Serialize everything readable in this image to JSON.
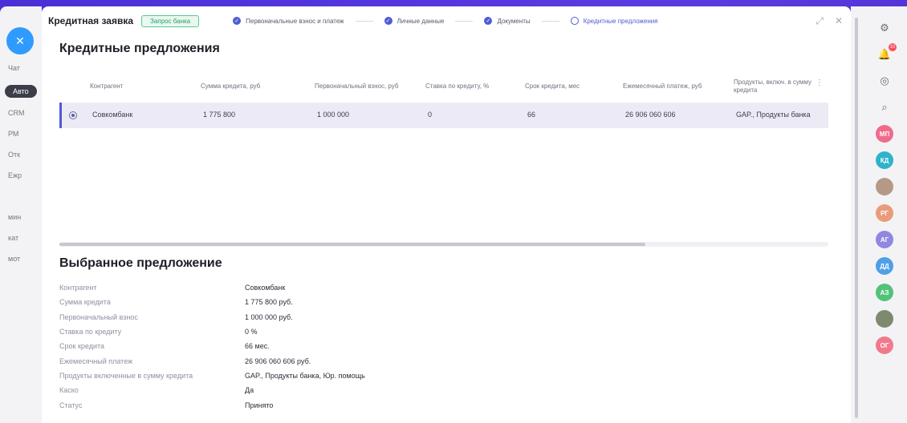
{
  "background_app": {
    "fab_icon": "close-icon",
    "items": [
      "Чат",
      "Авто",
      "CRM",
      "РМ",
      "Отк",
      "Ежр"
    ],
    "bottom_items": [
      "мин",
      "кат",
      "мот"
    ]
  },
  "header": {
    "title": "Кредитная заявка",
    "status": "Запрос банка",
    "steps": [
      {
        "label": "Первоначальные взнос и платеж",
        "state": "done"
      },
      {
        "label": "Личные данные",
        "state": "done"
      },
      {
        "label": "Документы",
        "state": "done"
      },
      {
        "label": "Кредитные предложения",
        "state": "current"
      }
    ]
  },
  "offers": {
    "title": "Кредитные предложения",
    "columns": [
      "Контрагент",
      "Сумма кредита, руб",
      "Первоначальный взнос, руб",
      "Ставка по кредиту, %",
      "Срок кредита, мес",
      "Ежемесячный платеж, руб",
      "Продукты, включ. в сумму кредита"
    ],
    "rows": [
      {
        "counterparty": "Совкомбанк",
        "amount": "1 775 800",
        "down_payment": "1 000 000",
        "rate": "0",
        "term": "66",
        "monthly": "26 906 060 606",
        "products": "GAP., Продукты банка"
      }
    ]
  },
  "selected": {
    "title": "Выбранное предложение",
    "fields": [
      {
        "label": "Контрагент",
        "value": "Совкомбанк"
      },
      {
        "label": "Сумма кредита",
        "value": "1 775 800 руб."
      },
      {
        "label": "Первоначальный взнос",
        "value": "1 000 000 руб."
      },
      {
        "label": "Ставка по кредиту",
        "value": "0 %"
      },
      {
        "label": "Срок кредита",
        "value": "66 мес."
      },
      {
        "label": "Ежемесячный платеж",
        "value": "26 906 060 606 руб."
      },
      {
        "label": "Продукты включенные в сумму кредита",
        "value": "GAP., Продукты банка, Юр. помощь"
      },
      {
        "label": "Каско",
        "value": "Да"
      },
      {
        "label": "Статус",
        "value": "Принято"
      }
    ]
  },
  "rail": {
    "badge_count": "10",
    "avatars": [
      {
        "initials": "МП",
        "color": "#f06b8a"
      },
      {
        "initials": "КД",
        "color": "#2fb3c9"
      },
      {
        "initials": "",
        "color": "#b49a86"
      },
      {
        "initials": "РГ",
        "color": "#e89c7a"
      },
      {
        "initials": "АГ",
        "color": "#8f88e0"
      },
      {
        "initials": "ДД",
        "color": "#4f9fe8"
      },
      {
        "initials": "АЗ",
        "color": "#52c27a"
      },
      {
        "initials": "",
        "color": "#7d8a70"
      },
      {
        "initials": "ОГ",
        "color": "#f07a8c"
      }
    ]
  }
}
